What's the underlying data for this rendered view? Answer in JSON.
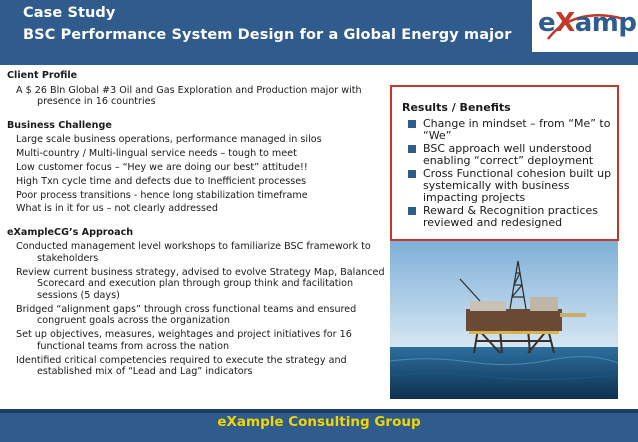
{
  "header": {
    "title_line1": "Case Study",
    "title_line2": "BSC Performance System Design for a Global Energy major",
    "logo_text_left": "e",
    "logo_text_x": "X",
    "logo_text_right": "ample"
  },
  "client_profile": {
    "heading": "Client Profile",
    "items": [
      "A $ 26 Bln Global #3 Oil and Gas Exploration and Production major  with presence in 16 countries"
    ]
  },
  "business_challenge": {
    "heading": "Business Challenge",
    "items": [
      "Large scale business operations, performance managed in silos",
      "Multi-country / Multi-lingual service needs – tough to meet",
      "Low customer focus – “Hey we are doing our best” attitude!!",
      "High Txn cycle time and defects due to Inefficient processes",
      "Poor process transitions - hence long stabilization timeframe",
      "What is in it for us – not clearly addressed"
    ]
  },
  "approach": {
    "heading": "eXampleCG’s Approach",
    "items": [
      "Conducted management level workshops to familiarize BSC framework to stakeholders",
      "Review current business strategy, advised to evolve Strategy Map, Balanced Scorecard and execution plan through group think and facilitation sessions (5 days)",
      "Bridged “alignment gaps” through cross functional teams and ensured congruent goals across the organization",
      "Set up objectives, measures, weightages and project initiatives for 16 functional teams from across the nation",
      "Identified critical competencies required to execute the strategy and established mix of “Lead and Lag” indicators"
    ]
  },
  "results": {
    "heading": "Results / Benefits",
    "items": [
      "Change in mindset – from “Me” to “We”",
      "BSC approach well understood enabling “correct” deployment",
      "Cross Functional cohesion built up systemically with business impacting projects",
      "Reward & Recognition practices reviewed and redesigned"
    ]
  },
  "footer": {
    "text": "eXample Consulting Group"
  },
  "colors": {
    "brand_blue": "#2f5b8d",
    "footer_text": "#f2d600",
    "results_border": "#c0392b"
  }
}
